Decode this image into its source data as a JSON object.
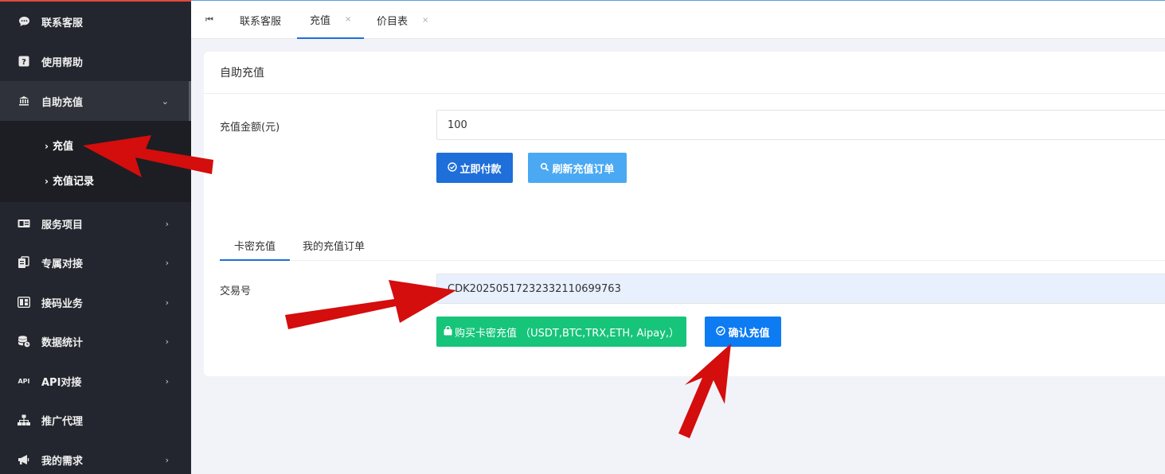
{
  "sidebar": {
    "items": [
      {
        "label": "联系客服",
        "icon": "chat-icon"
      },
      {
        "label": "使用帮助",
        "icon": "help-icon"
      },
      {
        "label": "自助充值",
        "icon": "bank-icon"
      },
      {
        "label": "服务项目",
        "icon": "card-icon"
      },
      {
        "label": "专属对接",
        "icon": "connect-icon"
      },
      {
        "label": "接码业务",
        "icon": "sim-icon"
      },
      {
        "label": "数据统计",
        "icon": "database-icon"
      },
      {
        "label": "API对接",
        "icon": "api-icon"
      },
      {
        "label": "推广代理",
        "icon": "sitemap-icon"
      },
      {
        "label": "我的需求",
        "icon": "megaphone-icon"
      }
    ],
    "submenu": [
      {
        "label": "充值"
      },
      {
        "label": "充值记录"
      }
    ]
  },
  "tabs": {
    "items": [
      {
        "label": "联系客服"
      },
      {
        "label": "充值"
      },
      {
        "label": "价目表"
      }
    ],
    "close": "×"
  },
  "card": {
    "title": "自助充值",
    "amount_label": "充值金额(元)",
    "amount_value": "100",
    "pay_button": "立即付款",
    "refresh_button": "刷新充值订单",
    "subtabs": [
      {
        "label": "卡密充值"
      },
      {
        "label": "我的充值订单"
      }
    ],
    "txn_label": "交易号",
    "txn_value": "CDK20250517232332110699763",
    "buy_button": "购买卡密充值 （USDT,BTC,TRX,ETH, Aipay,）",
    "confirm_button": "确认充值"
  },
  "colors": {
    "primary_blue": "#1e6fd9",
    "light_blue": "#4aa9f2",
    "green": "#16c47a",
    "confirm_blue": "#0d7bf2",
    "sidebar_bg": "#23262e",
    "arrow_red": "#d40d0d"
  }
}
